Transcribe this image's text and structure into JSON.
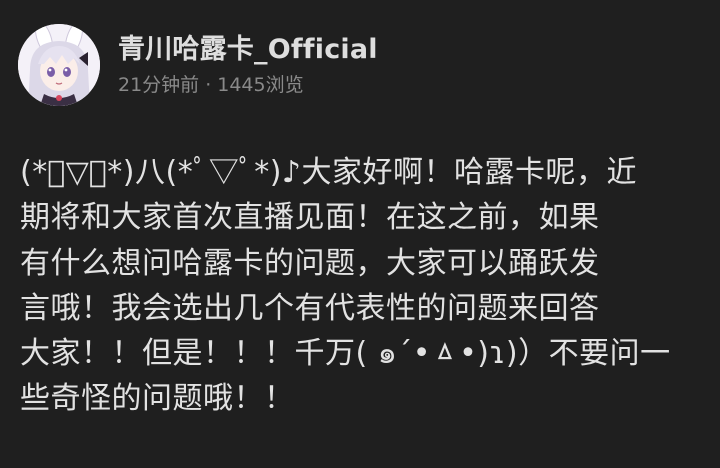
{
  "post": {
    "author": "青川哈露卡_Official",
    "time_ago": "21分钟前",
    "separator": "·",
    "views": "1445浏览",
    "content_lines": [
      "(*ﾟ▽ﾟ*)八(*ﾟ▽ﾟ*)♪大家好啊！哈露卡呢，近",
      "期将和大家首次直播见面！在这之前，如果",
      "有什么想问哈露卡的问题，大家可以踊跃发",
      "言哦！我会选出几个有代表性的问题来回答",
      "大家！！但是！！！千万( ๑´•ㅿ•)ɿ)）不要问一",
      "些奇怪的问题哦！！"
    ]
  },
  "colors": {
    "background": "#1f1f1f",
    "author_text": "#dedede",
    "meta_text": "#8a8a8a",
    "body_text": "#e2e2e2"
  },
  "icons": {
    "avatar": "anime-bunny-girl-avatar"
  }
}
